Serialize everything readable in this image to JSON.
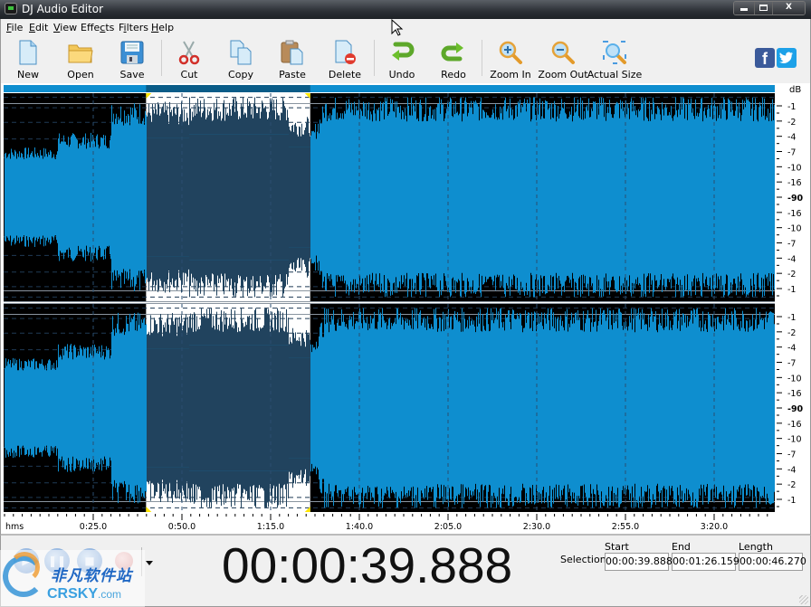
{
  "window": {
    "title": "DJ Audio Editor",
    "controls": [
      "minimize",
      "maximize",
      "close"
    ]
  },
  "menu": [
    {
      "label": "File",
      "mnemonic": "F"
    },
    {
      "label": "Edit",
      "mnemonic": "E"
    },
    {
      "label": "View",
      "mnemonic": "V"
    },
    {
      "label": "Effects",
      "mnemonic": "c"
    },
    {
      "label": "Filters",
      "mnemonic": "i"
    },
    {
      "label": "Help",
      "mnemonic": "H"
    }
  ],
  "toolbar": {
    "new": "New",
    "open": "Open",
    "save": "Save",
    "cut": "Cut",
    "copy": "Copy",
    "paste": "Paste",
    "delete": "Delete",
    "undo": "Undo",
    "redo": "Redo",
    "zoom_in": "Zoom In",
    "zoom_out": "Zoom Out",
    "actual_size": "Actual Size"
  },
  "social": {
    "facebook": "f",
    "twitter": "twitter-bird"
  },
  "waveform": {
    "channels": 2,
    "db_unit": "dB",
    "db_scale": [
      "-1",
      "-2",
      "-4",
      "-7",
      "-10",
      "-16",
      "-90",
      "-16",
      "-10",
      "-7",
      "-4",
      "-2",
      "-1"
    ],
    "timeline_unit": "hms",
    "timeline_labels": [
      "0:25.0",
      "0:50.0",
      "1:15.0",
      "1:40.0",
      "2:05.0",
      "2:30.0",
      "2:55.0",
      "3:20.0"
    ],
    "timeline_seconds": [
      25,
      50,
      75,
      100,
      125,
      150,
      175,
      200
    ],
    "visible_duration_seconds": 217,
    "selection_start_seconds": 39.888,
    "selection_end_seconds": 86.159,
    "colors": {
      "wave": "#0e8ecf",
      "wave_selected": "#21435e",
      "background": "#000000",
      "background_selected": "#ffffff",
      "overview": "#0e8ecf",
      "overview_selected": "#0a5c88",
      "marker": "#ffe600"
    }
  },
  "transport": {
    "buttons": [
      "play",
      "pause",
      "stop",
      "record"
    ],
    "current_time": "00:00:39.888"
  },
  "selection": {
    "label": "Selection",
    "start_label": "Start",
    "end_label": "End",
    "length_label": "Length",
    "start": "00:00:39.888",
    "end": "00:01:26.159",
    "length": "00:00:46.270"
  },
  "watermark": {
    "chinese": "非凡软件站",
    "brand": "CRSKY",
    "domain": ".com"
  }
}
